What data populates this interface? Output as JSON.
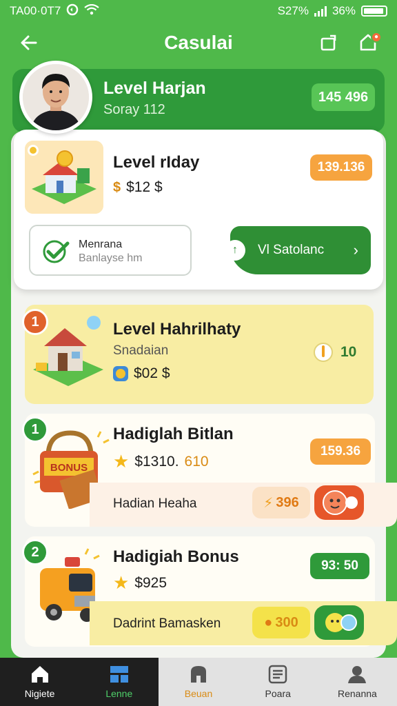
{
  "status_bar": {
    "time": "TA00·0T7",
    "right_text": "S27% ",
    "battery": "36%"
  },
  "app_bar": {
    "title": "Casulai"
  },
  "profile": {
    "title": "Level Harjan",
    "subtitle": "Soray 112",
    "badge": "145 496"
  },
  "daily_card": {
    "title": "Level rIday",
    "price": "$12 $",
    "badge": "139.136",
    "checkbox_label": "Menrana",
    "checkbox_sub": "Banlayse hm",
    "claim_label": "Vl Satolanc"
  },
  "level_card": {
    "rank": "1",
    "title": "Level Hahrilhaty",
    "subtitle": "Snadaian",
    "price": "$02 $",
    "points": "10"
  },
  "rewards": [
    {
      "rank": "1",
      "title": "Hadiglah Bitlan",
      "price_a": "$1310.",
      "price_b": "610",
      "badge": "159.36",
      "footer": "Hadian Heaha",
      "chip": "396",
      "badge_color": "#f6a43f"
    },
    {
      "rank": "2",
      "title": "Hadigiah Bonus",
      "price_a": "$925",
      "price_b": "",
      "badge": "93: 50",
      "footer": "Dadrint Bamasken",
      "chip": "300",
      "badge_color": "#2f9a3a"
    }
  ],
  "nav": [
    {
      "label": "Nigiete",
      "icon": "home-icon"
    },
    {
      "label": "Lenne",
      "icon": "grid-icon"
    },
    {
      "label": "Beuan",
      "icon": "bag-icon"
    },
    {
      "label": "Poara",
      "icon": "list-icon"
    },
    {
      "label": "Renanna",
      "icon": "person-icon"
    }
  ],
  "colors": {
    "brand_green": "#4fb94a",
    "dark_green": "#2f9a3a",
    "orange": "#f6a43f",
    "yellow": "#f8eda3"
  }
}
